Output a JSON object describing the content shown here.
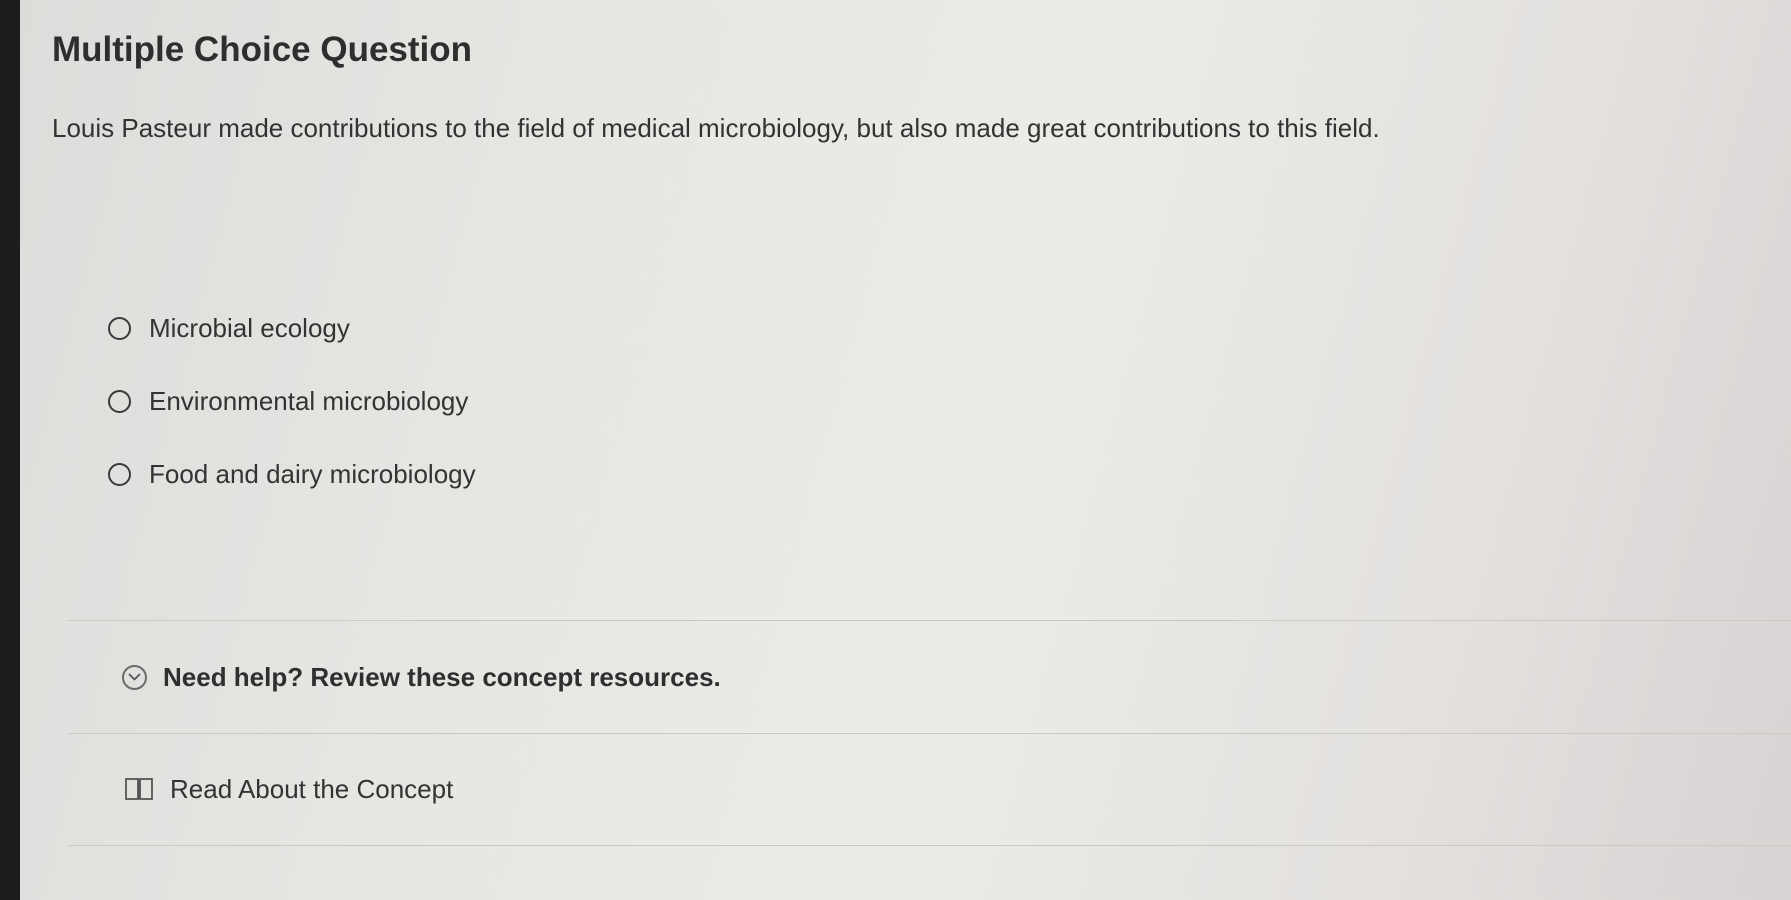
{
  "question": {
    "title": "Multiple Choice Question",
    "prompt": "Louis Pasteur made contributions to the field of medical microbiology, but also made great contributions to this field."
  },
  "options": [
    {
      "label": "Microbial ecology",
      "selected": false
    },
    {
      "label": "Environmental microbiology",
      "selected": false
    },
    {
      "label": "Food and dairy microbiology",
      "selected": false
    }
  ],
  "help": {
    "title": "Need help? Review these concept resources.",
    "expand_icon": "chevron-down-circle-icon",
    "resources": [
      {
        "label": "Read About the Concept",
        "icon": "book-icon"
      }
    ]
  }
}
